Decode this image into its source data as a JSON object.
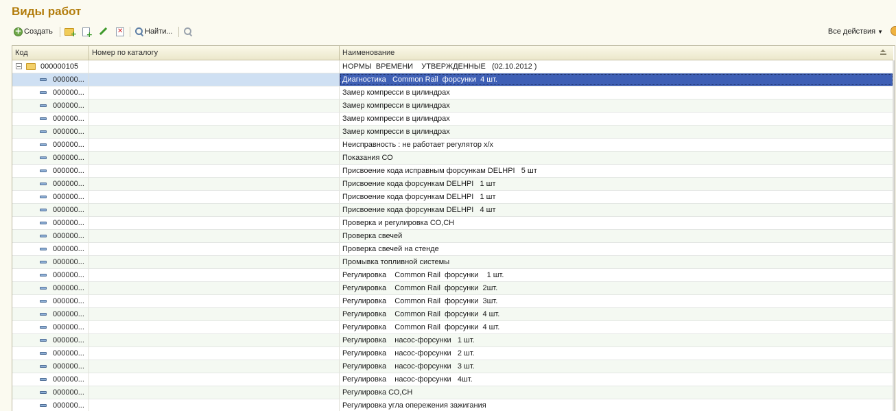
{
  "title": "Виды работ",
  "toolbar": {
    "create_label": "Создать",
    "find_label": "Найти...",
    "all_actions_label": "Все действия"
  },
  "columns": {
    "code": "Код",
    "catalog": "Номер по каталогу",
    "name": "Наименование"
  },
  "group": {
    "code": "000000105",
    "name": "НОРМЫ  ВРЕМЕНИ    УТВЕРЖДЕННЫЕ   (02.10.2012 )"
  },
  "items": [
    {
      "code": "000000...",
      "name": "Диагностика   Common Rail  форсунки  4 шт.",
      "selected": true
    },
    {
      "code": "000000...",
      "name": "Замер компресси в цилиндрах"
    },
    {
      "code": "000000...",
      "name": "Замер компресси в цилиндрах"
    },
    {
      "code": "000000...",
      "name": "Замер компресси в цилиндрах"
    },
    {
      "code": "000000...",
      "name": "Замер компресси в цилиндрах"
    },
    {
      "code": "000000...",
      "name": "Неисправность : не работает регулятор х/х"
    },
    {
      "code": "000000...",
      "name": "Показания СО"
    },
    {
      "code": "000000...",
      "name": "Присвоение кода исправным форсункам DELHPI   5 шт"
    },
    {
      "code": "000000...",
      "name": "Присвоение кода форсункам DELHPI   1 шт"
    },
    {
      "code": "000000...",
      "name": "Присвоение кода форсункам DELHPI   1 шт"
    },
    {
      "code": "000000...",
      "name": "Присвоение кода форсункам DELHPI   4 шт"
    },
    {
      "code": "000000...",
      "name": "Проверка и регулировка СО,СН"
    },
    {
      "code": "000000...",
      "name": "Проверка свечей"
    },
    {
      "code": "000000...",
      "name": "Проверка свечей на стенде"
    },
    {
      "code": "000000...",
      "name": "Промывка топливной системы"
    },
    {
      "code": "000000...",
      "name": "Регулировка    Common Rail  форсунки    1 шт."
    },
    {
      "code": "000000...",
      "name": "Регулировка    Common Rail  форсунки  2шт."
    },
    {
      "code": "000000...",
      "name": "Регулировка    Common Rail  форсунки  3шт."
    },
    {
      "code": "000000...",
      "name": "Регулировка    Common Rail  форсунки  4 шт."
    },
    {
      "code": "000000...",
      "name": "Регулировка    Common Rail  форсунки  4 шт."
    },
    {
      "code": "000000...",
      "name": "Регулировка    насос-форсунки   1 шт."
    },
    {
      "code": "000000...",
      "name": "Регулировка    насос-форсунки   2 шт."
    },
    {
      "code": "000000...",
      "name": "Регулировка    насос-форсунки   3 шт."
    },
    {
      "code": "000000...",
      "name": "Регулировка    насос-форсунки   4шт."
    },
    {
      "code": "000000...",
      "name": "Регулировка СО,СН"
    },
    {
      "code": "000000...",
      "name": "Регулировка угла опережения зажигания"
    }
  ]
}
